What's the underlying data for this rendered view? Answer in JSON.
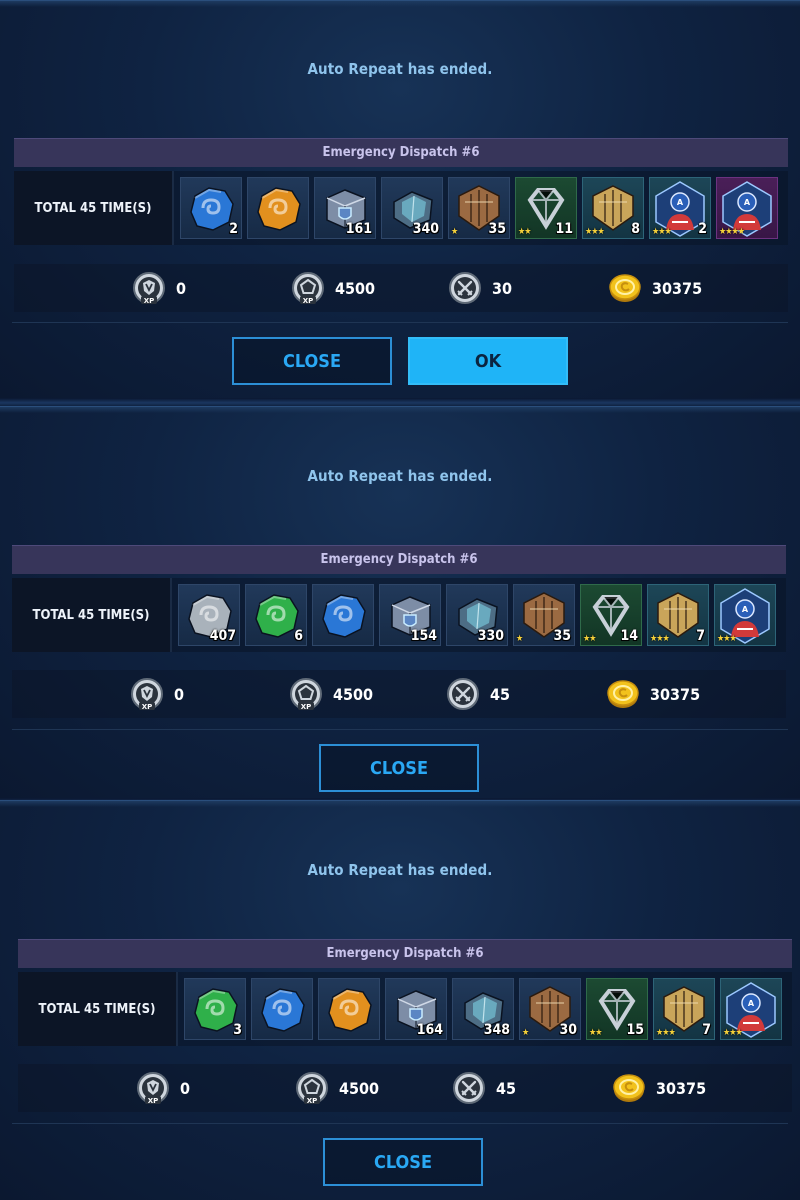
{
  "screens": [
    {
      "message": "Auto Repeat has ended.",
      "panel_title": "Emergency Dispatch #6",
      "total_label": "TOTAL 45 TIME(S)",
      "items": [
        {
          "name": "blue-ore",
          "qty": "2",
          "stars": ""
        },
        {
          "name": "orange-ore",
          "qty": "",
          "stars": ""
        },
        {
          "name": "shield-box",
          "qty": "161",
          "stars": ""
        },
        {
          "name": "crystal-box",
          "qty": "340",
          "stars": ""
        },
        {
          "name": "bronze-uniform-emblem",
          "qty": "35",
          "stars": "★"
        },
        {
          "name": "silver-uniform-emblem",
          "qty": "11",
          "stars": "★★"
        },
        {
          "name": "gold-uniform-emblem",
          "qty": "8",
          "stars": "★★★"
        },
        {
          "name": "captain-america-card",
          "qty": "2",
          "stars": "★★★"
        },
        {
          "name": "captain-america-card",
          "qty": "",
          "stars": "★★★★"
        }
      ],
      "currencies": [
        {
          "icon": "shield-xp-icon",
          "value": "0"
        },
        {
          "icon": "pentagon-xp-icon",
          "value": "4500"
        },
        {
          "icon": "crossed-swords-icon",
          "value": "30"
        },
        {
          "icon": "gold-coin-icon",
          "value": "30375"
        }
      ],
      "buttons": {
        "close": "CLOSE",
        "ok": "OK"
      }
    },
    {
      "message": "Auto Repeat has ended.",
      "panel_title": "Emergency Dispatch #6",
      "total_label": "TOTAL 45 TIME(S)",
      "items": [
        {
          "name": "gray-ore",
          "qty": "407",
          "stars": ""
        },
        {
          "name": "green-ore",
          "qty": "6",
          "stars": ""
        },
        {
          "name": "blue-ore",
          "qty": "",
          "stars": ""
        },
        {
          "name": "shield-box",
          "qty": "154",
          "stars": ""
        },
        {
          "name": "crystal-box",
          "qty": "330",
          "stars": ""
        },
        {
          "name": "bronze-uniform-emblem",
          "qty": "35",
          "stars": "★"
        },
        {
          "name": "silver-uniform-emblem",
          "qty": "14",
          "stars": "★★"
        },
        {
          "name": "gold-uniform-emblem",
          "qty": "7",
          "stars": "★★★"
        },
        {
          "name": "captain-america-card",
          "qty": "",
          "stars": "★★★"
        }
      ],
      "currencies": [
        {
          "icon": "shield-xp-icon",
          "value": "0"
        },
        {
          "icon": "pentagon-xp-icon",
          "value": "4500"
        },
        {
          "icon": "crossed-swords-icon",
          "value": "45"
        },
        {
          "icon": "gold-coin-icon",
          "value": "30375"
        }
      ],
      "buttons": {
        "close": "CLOSE"
      }
    },
    {
      "message": "Auto Repeat has ended.",
      "panel_title": "Emergency Dispatch #6",
      "total_label": "TOTAL 45 TIME(S)",
      "items": [
        {
          "name": "green-ore",
          "qty": "3",
          "stars": ""
        },
        {
          "name": "blue-ore",
          "qty": "",
          "stars": ""
        },
        {
          "name": "orange-ore",
          "qty": "",
          "stars": ""
        },
        {
          "name": "shield-box",
          "qty": "164",
          "stars": ""
        },
        {
          "name": "crystal-box",
          "qty": "348",
          "stars": ""
        },
        {
          "name": "bronze-uniform-emblem",
          "qty": "30",
          "stars": "★"
        },
        {
          "name": "silver-uniform-emblem",
          "qty": "15",
          "stars": "★★"
        },
        {
          "name": "gold-uniform-emblem",
          "qty": "7",
          "stars": "★★★"
        },
        {
          "name": "captain-america-card",
          "qty": "",
          "stars": "★★★"
        }
      ],
      "currencies": [
        {
          "icon": "shield-xp-icon",
          "value": "0"
        },
        {
          "icon": "pentagon-xp-icon",
          "value": "4500"
        },
        {
          "icon": "crossed-swords-icon",
          "value": "45"
        },
        {
          "icon": "gold-coin-icon",
          "value": "30375"
        }
      ],
      "buttons": {
        "close": "CLOSE"
      }
    }
  ],
  "colors": {
    "accent": "#1fb4f7",
    "panel_title_bg": "#37355a",
    "message_text": "#8fc4ec",
    "star": "#f4d03a"
  }
}
